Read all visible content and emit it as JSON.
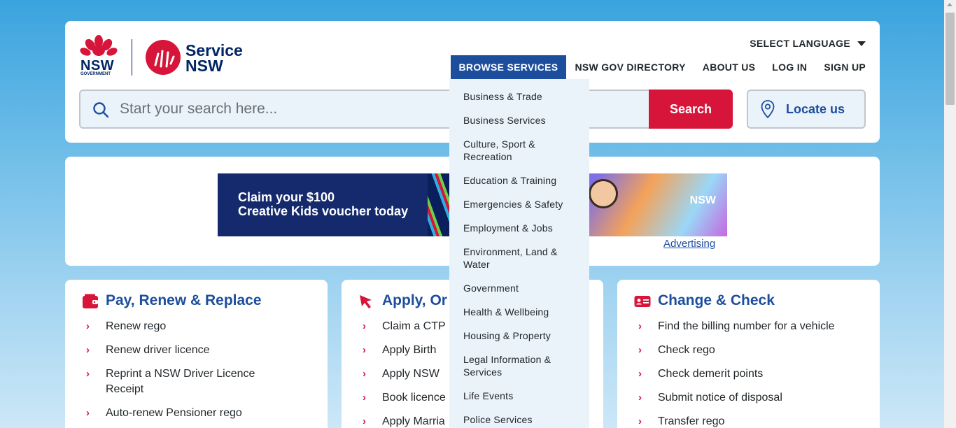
{
  "brand": {
    "nsw_text": "NSW",
    "nsw_gov_text": "GOVERNMENT",
    "service_line1": "Service",
    "service_line2": "NSW",
    "primary_color": "#002664",
    "accent_color": "#d7153a",
    "nav_active_color": "#1d4e9e"
  },
  "header": {
    "language_label": "SELECT LANGUAGE",
    "nav": [
      {
        "label": "BROWSE SERVICES"
      },
      {
        "label": "NSW GOV DIRECTORY"
      },
      {
        "label": "ABOUT US"
      },
      {
        "label": "LOG IN"
      },
      {
        "label": "SIGN UP"
      }
    ],
    "search_placeholder": "Start your search here...",
    "search_button": "Search",
    "locate_button": "Locate us"
  },
  "promo": {
    "line1": "Claim your $100",
    "line2": "Creative Kids voucher today",
    "nsw_mark": "NSW",
    "advertising_link": "Advertising"
  },
  "columns": [
    {
      "title": "Pay, Renew & Replace",
      "icon": "wallet-icon",
      "items": [
        "Renew rego",
        "Renew driver licence",
        "Reprint a NSW Driver Licence Receipt",
        "Auto-renew Pensioner rego"
      ]
    },
    {
      "title": "Apply, Or",
      "icon": "cursor-icon",
      "items": [
        "Claim a CTP",
        "Apply Birth",
        "Apply NSW",
        "Book licence",
        "Apply Marria"
      ]
    },
    {
      "title": "Change & Check",
      "icon": "id-card-icon",
      "items": [
        "Find the billing number for a vehicle",
        "Check rego",
        "Check demerit points",
        "Submit notice of disposal",
        "Transfer rego"
      ]
    }
  ],
  "dropdown": {
    "items": [
      "Business & Trade",
      "Business Services",
      "Culture, Sport & Recreation",
      "Education & Training",
      "Emergencies & Safety",
      "Employment & Jobs",
      "Environment, Land & Water",
      "Government",
      "Health & Wellbeing",
      "Housing & Property",
      "Legal Information & Services",
      "Life Events",
      "Police Services"
    ]
  }
}
